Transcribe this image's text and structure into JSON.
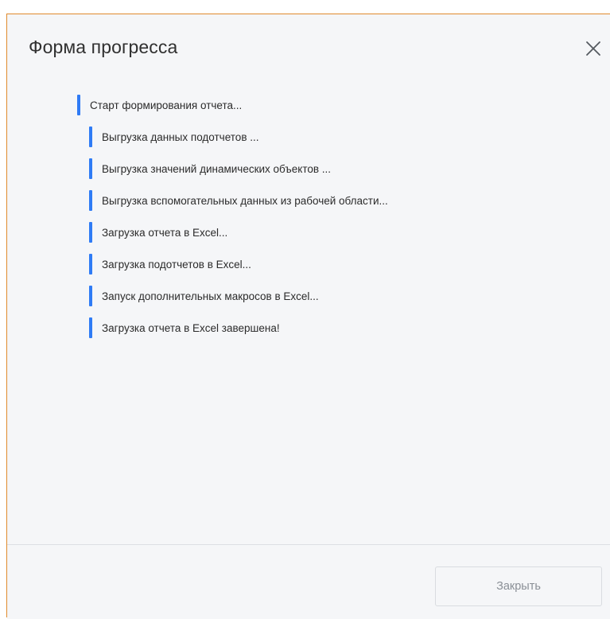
{
  "dialog": {
    "title": "Форма прогресса",
    "close_icon": "close-icon",
    "close_button_label": "Закрыть"
  },
  "log": {
    "items": [
      {
        "text": "Старт формирования отчета...",
        "level": 0
      },
      {
        "text": "Выгрузка данных подотчетов ...",
        "level": 1
      },
      {
        "text": "Выгрузка значений динамических объектов ...",
        "level": 1
      },
      {
        "text": "Выгрузка вспомогательных данных из рабочей области...",
        "level": 1
      },
      {
        "text": "Загрузка отчета в Excel...",
        "level": 1
      },
      {
        "text": "Загрузка подотчетов в Excel...",
        "level": 1
      },
      {
        "text": "Запуск дополнительных макросов в Excel...",
        "level": 1
      },
      {
        "text": "Загрузка отчета в Excel завершена!",
        "level": 1
      }
    ]
  },
  "colors": {
    "accent_bar": "#2f7bf5",
    "dialog_border": "#e08a2c",
    "background": "#f5f6f8"
  }
}
